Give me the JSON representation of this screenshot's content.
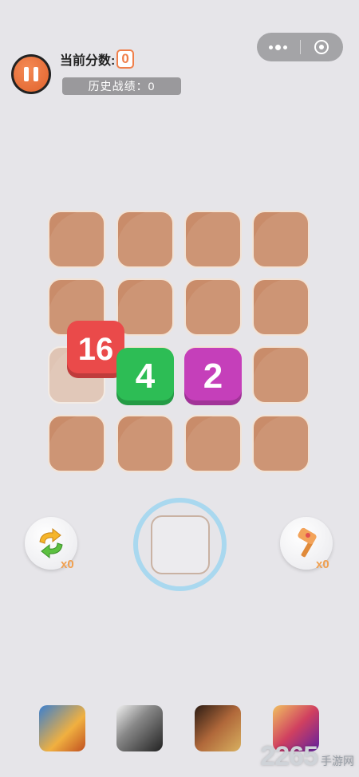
{
  "header": {
    "score_label": "当前分数:",
    "score_value": "0",
    "history_label": "历史战绩：0"
  },
  "capsule": {
    "more_icon": "more-dots-icon",
    "close_icon": "target-circle-icon"
  },
  "board": {
    "rows": 4,
    "cols": 4,
    "tiles": [
      {
        "value": "16",
        "color": "#ea4a4a"
      },
      {
        "value": "4",
        "color": "#2dbd55"
      },
      {
        "value": "2",
        "color": "#c53fba"
      }
    ]
  },
  "tools": {
    "undo": {
      "icon": "undo-arrows-icon",
      "count": "x0"
    },
    "hammer": {
      "icon": "hammer-icon",
      "count": "x0"
    }
  },
  "watermark": {
    "number": "2265",
    "text": "手游网"
  }
}
